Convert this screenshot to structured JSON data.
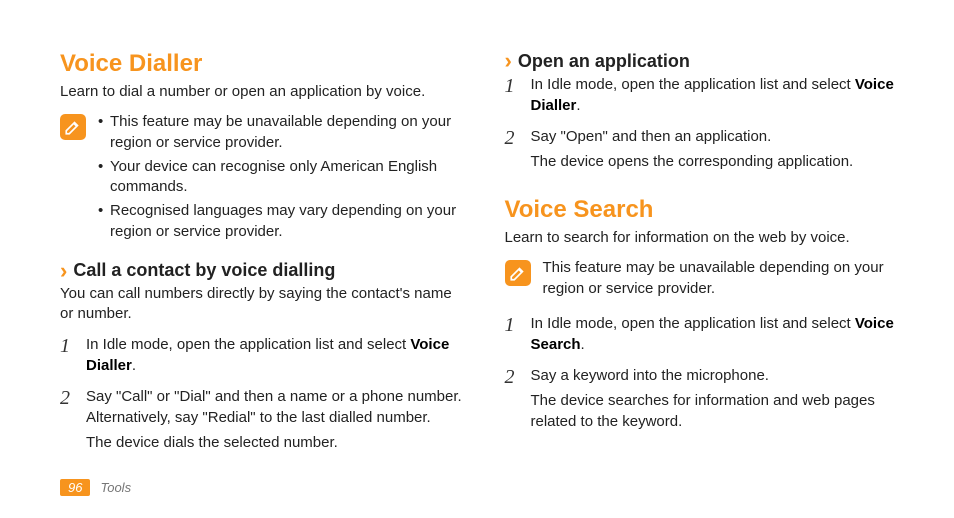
{
  "left": {
    "title": "Voice Dialler",
    "intro": "Learn to dial a number or open an application by voice.",
    "notes": [
      "This feature may be unavailable depending on your region or service provider.",
      "Your device can recognise only American English commands.",
      "Recognised languages may vary depending on your region or service provider."
    ],
    "subheading": "Call a contact by voice dialling",
    "subintro": "You can call numbers directly by saying the contact's name or number.",
    "step1_pre": "In Idle mode, open the application list and select ",
    "step1_bold": "Voice Dialler",
    "step1_post": ".",
    "step2_a": "Say \"Call\" or \"Dial\" and then a name or a phone number. Alternatively, say \"Redial\" to the last dialled number.",
    "step2_b": "The device dials the selected number."
  },
  "right": {
    "subheading1": "Open an application",
    "r1_step1_pre": "In Idle mode, open the application list and select ",
    "r1_step1_bold": "Voice Dialler",
    "r1_step1_post": ".",
    "r1_step2_a": "Say \"Open\" and then an application.",
    "r1_step2_b": "The device opens the corresponding application.",
    "title2": "Voice Search",
    "intro2": "Learn to search for information on the web by voice.",
    "note2": "This feature may be unavailable depending on your region or service provider.",
    "r2_step1_pre": "In Idle mode, open the application list and select ",
    "r2_step1_bold": "Voice Search",
    "r2_step1_post": ".",
    "r2_step2_a": " Say a keyword into the microphone.",
    "r2_step2_b": "The device searches for information and web pages related to the keyword."
  },
  "footer": {
    "page": "96",
    "section": "Tools"
  }
}
